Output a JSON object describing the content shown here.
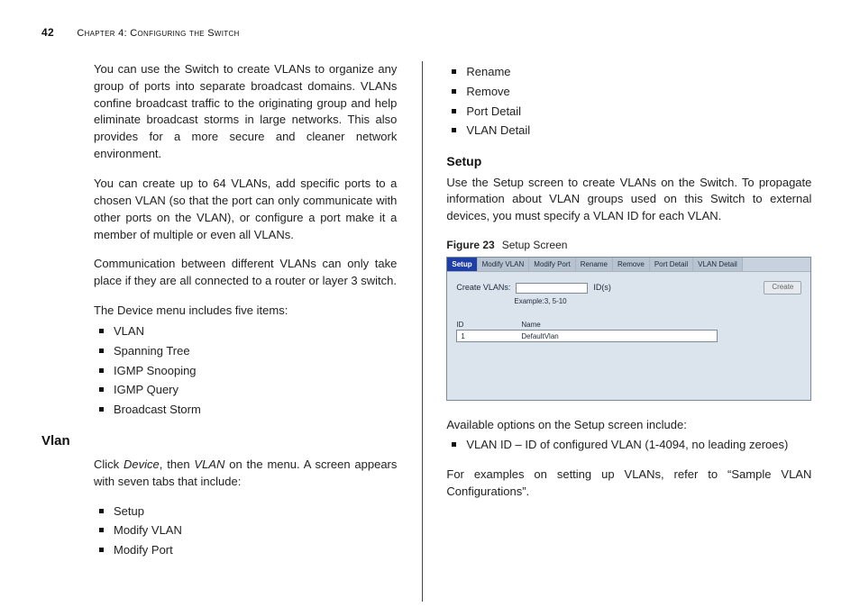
{
  "header": {
    "page_number": "42",
    "chapter_label": "Chapter 4: Configuring the Switch"
  },
  "left": {
    "p1": "You can use the Switch to create VLANs to organize any group of ports into separate broadcast domains. VLANs confine broadcast traffic to the originating group and help eliminate broadcast storms in large networks. This also provides for a more secure and cleaner network environment.",
    "p2": "You can create up to 64 VLANs, add specific ports to a chosen VLAN (so that the port can only communicate with other ports on the VLAN), or configure a port make it a member of multiple or even all VLANs.",
    "p3": "Communication between different VLANs can only take place if they are all connected to a router or layer 3 switch.",
    "p4": "The Device menu includes five items:",
    "device_items": [
      "VLAN",
      "Spanning Tree",
      "IGMP Snooping",
      "IGMP Query",
      "Broadcast Storm"
    ],
    "vlan_heading": "Vlan",
    "p5_prefix": "Click ",
    "p5_em1": "Device",
    "p5_mid": ", then ",
    "p5_em2": "VLAN",
    "p5_suffix": " on the menu. A screen appears with seven tabs that include:",
    "tabs_left": [
      "Setup",
      "Modify VLAN",
      "Modify Port"
    ]
  },
  "right": {
    "tabs_top": [
      "Rename",
      "Remove",
      "Port Detail",
      "VLAN Detail"
    ],
    "setup_heading": "Setup",
    "setup_p": "Use the Setup screen to create VLANs on the Switch. To propagate information about VLAN groups used on this Switch to external devices, you must specify a VLAN ID for each VLAN.",
    "figure_label": "Figure 23",
    "figure_title": "Setup Screen",
    "screenshot": {
      "tabs": [
        "Setup",
        "Modify VLAN",
        "Modify Port",
        "Rename",
        "Remove",
        "Port Detail",
        "VLAN Detail"
      ],
      "create_label": "Create VLANs:",
      "ids_label": "ID(s)",
      "create_btn": "Create",
      "example": "Example:3, 5-10",
      "table_head_id": "ID",
      "table_head_name": "Name",
      "row1_id": "1",
      "row1_name": "DefaultVlan"
    },
    "avail_p": "Available options on the Setup screen include:",
    "setup_bullets": [
      "VLAN ID – ID of configured VLAN (1-4094, no leading zeroes)"
    ],
    "sample_p": "For examples on setting up VLANs, refer to “Sample VLAN Configurations”."
  }
}
